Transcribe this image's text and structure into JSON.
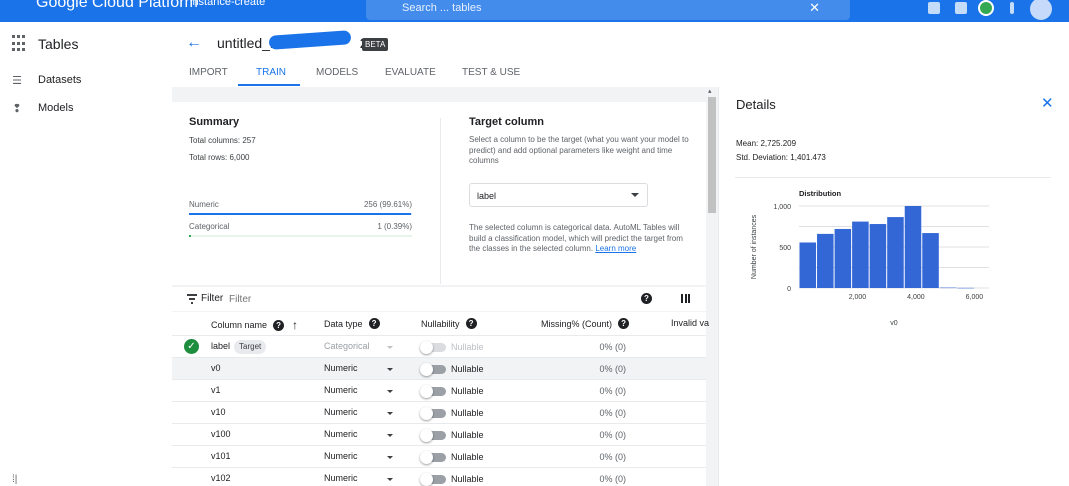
{
  "topbar": {
    "brand": "Google Cloud Platform",
    "project": "instance-create",
    "search_placeholder": "Search ... tables",
    "search_close": "✕"
  },
  "leftnav": {
    "title": "Tables",
    "items": [
      {
        "label": "Datasets",
        "icon": "list-icon"
      },
      {
        "label": "Models",
        "icon": "lightbulb-icon"
      }
    ]
  },
  "header": {
    "title_prefix": "untitled_1",
    "title_suffix": "2",
    "badge": "BETA"
  },
  "tabs": [
    {
      "label": "IMPORT",
      "active": false
    },
    {
      "label": "TRAIN",
      "active": true
    },
    {
      "label": "MODELS",
      "active": false
    },
    {
      "label": "EVALUATE",
      "active": false
    },
    {
      "label": "TEST & USE",
      "active": false
    }
  ],
  "summary": {
    "title": "Summary",
    "total_columns": "Total columns: 257",
    "total_rows": "Total rows: 6,000",
    "bars": [
      {
        "label": "Numeric",
        "value": "256 (99.61%)",
        "fraction": 0.9961
      },
      {
        "label": "Categorical",
        "value": "1 (0.39%)",
        "fraction": 0.0039
      }
    ]
  },
  "target": {
    "title": "Target column",
    "description": "Select a column to be the target (what you want your model to predict) and add optional parameters like weight and time columns",
    "selected": "label",
    "note": "The selected column is categorical data. AutoML Tables will build a classification model, which will predict the target from the classes in the selected column.",
    "learn_more": "Learn more"
  },
  "filter": {
    "label": "Filter",
    "placeholder": "Filter"
  },
  "table": {
    "headers": {
      "column_name": "Column name",
      "data_type": "Data type",
      "nullability": "Nullability",
      "missing": "Missing% (Count)",
      "invalid": "Invalid va"
    },
    "rows": [
      {
        "name": "label",
        "chip": "Target",
        "type": "Categorical",
        "nullable": "Nullable",
        "missing": "0% (0)",
        "is_target": true
      },
      {
        "name": "v0",
        "type": "Numeric",
        "nullable": "Nullable",
        "missing": "0% (0)",
        "highlighted": true
      },
      {
        "name": "v1",
        "type": "Numeric",
        "nullable": "Nullable",
        "missing": "0% (0)"
      },
      {
        "name": "v10",
        "type": "Numeric",
        "nullable": "Nullable",
        "missing": "0% (0)"
      },
      {
        "name": "v100",
        "type": "Numeric",
        "nullable": "Nullable",
        "missing": "0% (0)"
      },
      {
        "name": "v101",
        "type": "Numeric",
        "nullable": "Nullable",
        "missing": "0% (0)"
      },
      {
        "name": "v102",
        "type": "Numeric",
        "nullable": "Nullable",
        "missing": "0% (0)"
      }
    ]
  },
  "details": {
    "title": "Details",
    "mean_label": "Mean:",
    "mean_value": "2,725.209",
    "std_label": "Std. Deviation:",
    "std_value": "1,401.473"
  },
  "chart_data": {
    "type": "bar",
    "title": "Distribution",
    "xlabel": "v0",
    "ylabel": "Number of instances",
    "bins": [
      {
        "x0": 0,
        "x1": 600,
        "value": 555
      },
      {
        "x0": 600,
        "x1": 1200,
        "value": 660
      },
      {
        "x0": 1200,
        "x1": 1800,
        "value": 720
      },
      {
        "x0": 1800,
        "x1": 2400,
        "value": 810
      },
      {
        "x0": 2400,
        "x1": 3000,
        "value": 780
      },
      {
        "x0": 3000,
        "x1": 3600,
        "value": 865
      },
      {
        "x0": 3600,
        "x1": 4200,
        "value": 1000
      },
      {
        "x0": 4200,
        "x1": 4800,
        "value": 670
      },
      {
        "x0": 4800,
        "x1": 5400,
        "value": 5
      },
      {
        "x0": 5400,
        "x1": 6000,
        "value": 2
      }
    ],
    "xticks": [
      2000,
      4000,
      6000
    ],
    "xtick_labels": [
      "2,000",
      "4,000",
      "6,000"
    ],
    "yticks": [
      0,
      500,
      1000
    ],
    "ytick_labels": [
      "0",
      "500",
      "1,000"
    ],
    "xlim": [
      0,
      6500
    ],
    "ylim": [
      0,
      1000
    ],
    "bar_color": "#3367d6",
    "grid": true
  },
  "colors": {
    "accent": "#1a73e8",
    "success": "#1e8e3e"
  }
}
